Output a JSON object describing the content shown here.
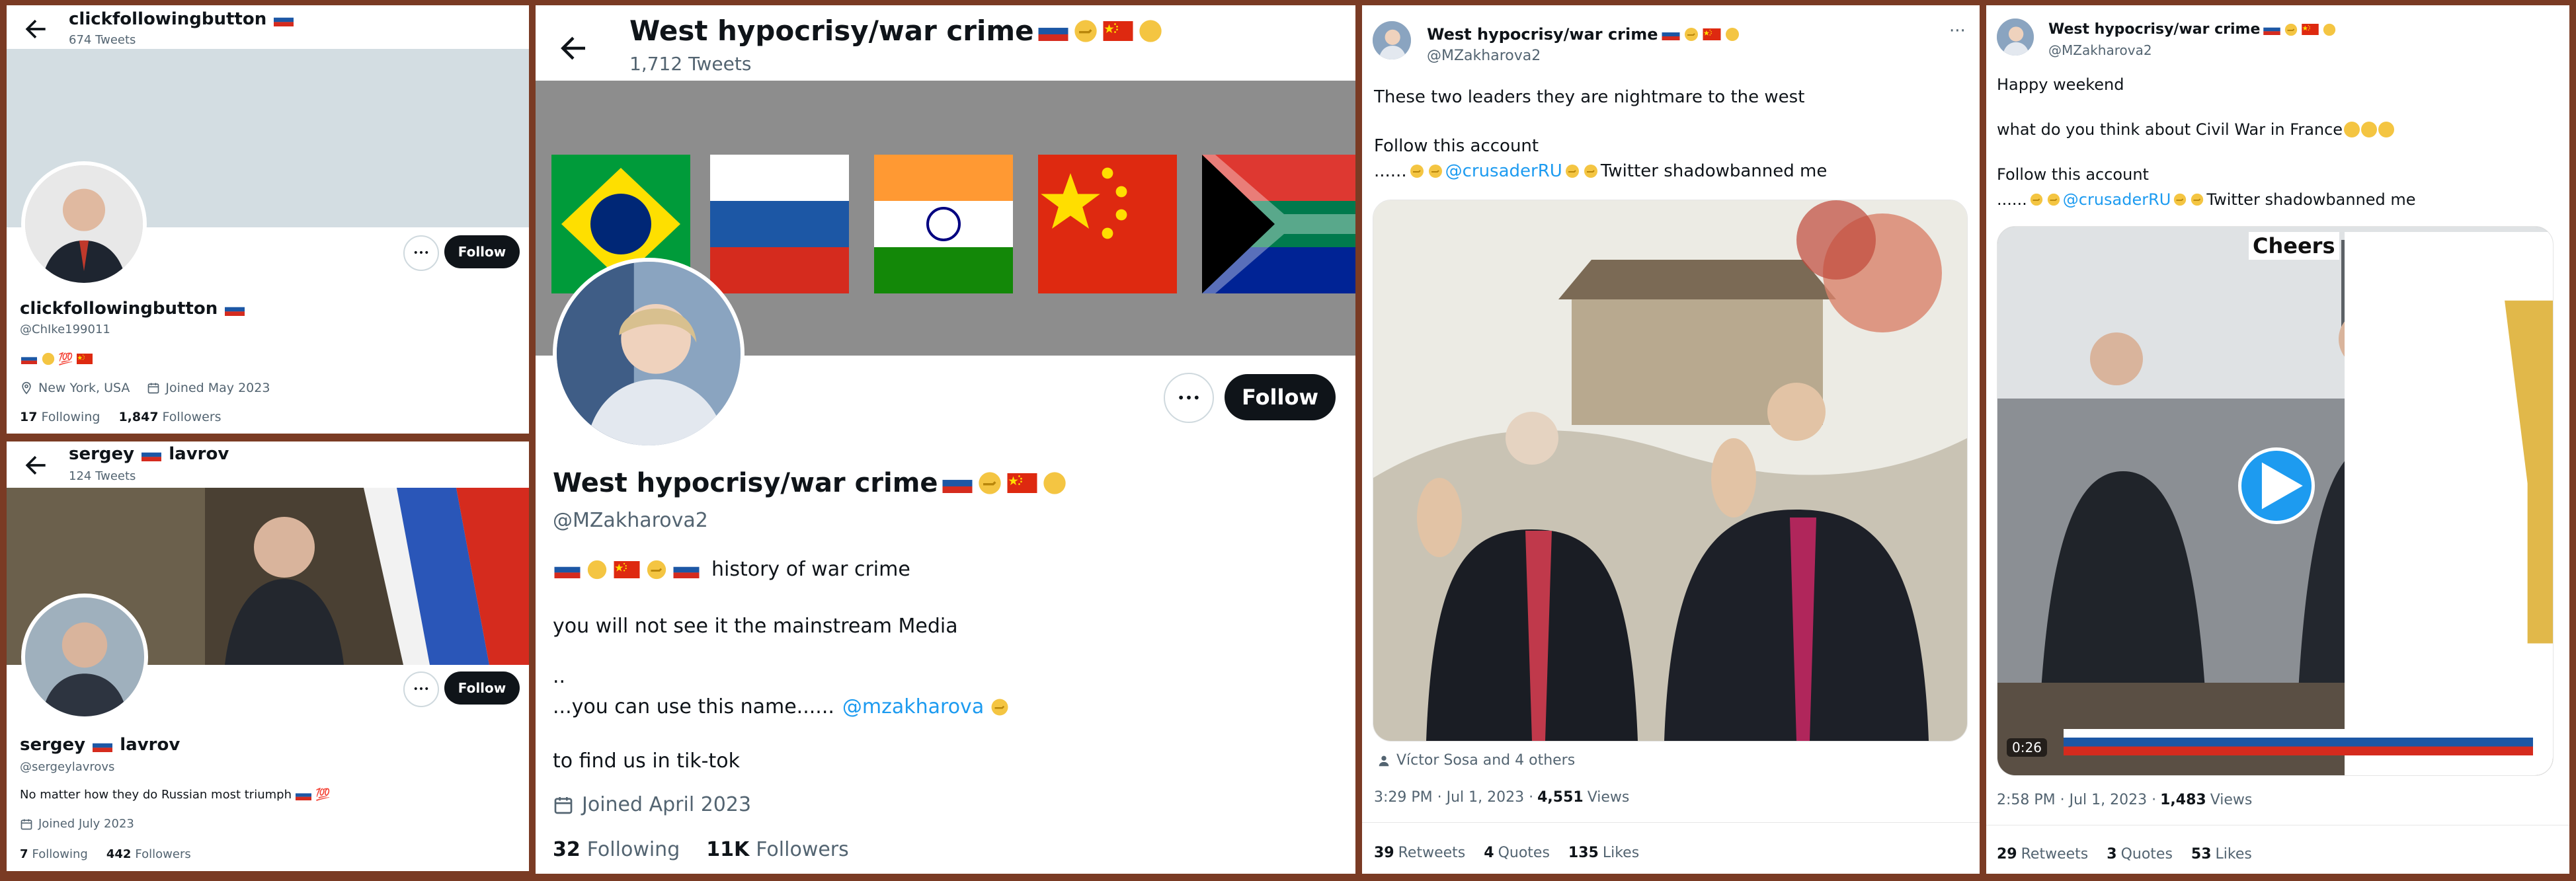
{
  "panel1": {
    "header_name": "clickfollowingbutton",
    "header_count": "674 Tweets",
    "display_name": "clickfollowingbutton",
    "handle": "@ChIke199011",
    "location": "New York, USA",
    "joined": "Joined May 2023",
    "following_count": "17",
    "following_label": "Following",
    "followers_count": "1,847",
    "followers_label": "Followers",
    "follow_label": "Follow",
    "more_label": "•••"
  },
  "panel2": {
    "header_name": "sergey",
    "header_name_suffix": "lavrov",
    "header_count": "124 Tweets",
    "display_name": "sergey",
    "display_name_suffix": "lavrov",
    "handle": "@sergeylavrovs",
    "bio": "No matter how  they do Russian most triumph",
    "joined": "Joined July 2023",
    "following_count": "7",
    "following_label": "Following",
    "followers_count": "442",
    "followers_label": "Followers",
    "follow_label": "Follow",
    "more_label": "•••"
  },
  "panel3": {
    "header_name": "West hypocrisy/war crime",
    "header_count": "1,712 Tweets",
    "display_name": "West hypocrisy/war crime",
    "handle": "@MZakharova2",
    "bio_line1": "history of war crime",
    "bio_line2": "you will not see it the mainstream Media",
    "bio_line3": "..",
    "bio_line4_prefix": "...you can use this name......",
    "bio_line4_mention": "@mzakharova",
    "bio_line5": "to find us in tik-tok",
    "joined": "Joined April 2023",
    "following_count": "32",
    "following_label": "Following",
    "followers_count": "11K",
    "followers_label": "Followers",
    "follow_label": "Follow",
    "more_label": "•••"
  },
  "panel4": {
    "author_name": "West hypocrisy/war crime",
    "author_handle": "@MZakharova2",
    "more_label": "···",
    "text_line1": "These two leaders they are nightmare to the west",
    "text_line2": "Follow this account",
    "text_line3_prefix": "......",
    "text_line3_mention": "@crusaderRU",
    "text_line3_suffix": "Twitter shadowbanned me",
    "tagged": "Víctor Sosa and 4 others",
    "timestamp": "3:29 PM · Jul 1, 2023 ·",
    "views_count": "4,551",
    "views_label": "Views",
    "retweets_count": "39",
    "retweets_label": "Retweets",
    "quotes_count": "4",
    "quotes_label": "Quotes",
    "likes_count": "135",
    "likes_label": "Likes"
  },
  "panel5": {
    "author_name": "West hypocrisy/war crime",
    "author_handle": "@MZakharova2",
    "more_label": "···",
    "text_line1": "Happy weekend",
    "text_line2": "what do you think about Civil War in France",
    "text_line3": "Follow this account",
    "text_line4_prefix": "......",
    "text_line4_mention": "@crusaderRU",
    "text_line4_suffix": "Twitter shadowbanned me",
    "video_caption": "Cheers",
    "video_duration": "0:26",
    "timestamp": "2:58 PM · Jul 1, 2023 ·",
    "views_count": "1,483",
    "views_label": "Views",
    "retweets_count": "29",
    "retweets_label": "Retweets",
    "quotes_count": "3",
    "quotes_label": "Quotes",
    "likes_count": "53",
    "likes_label": "Likes"
  },
  "icons": {
    "back": "back-arrow-icon",
    "location": "location-pin-icon",
    "calendar": "calendar-icon",
    "person": "person-icon",
    "play": "play-icon"
  },
  "colors": {
    "accent": "#1d9bf0",
    "follow_bg": "#0f1419",
    "muted": "#536471",
    "background_frame": "#7a3b24"
  }
}
